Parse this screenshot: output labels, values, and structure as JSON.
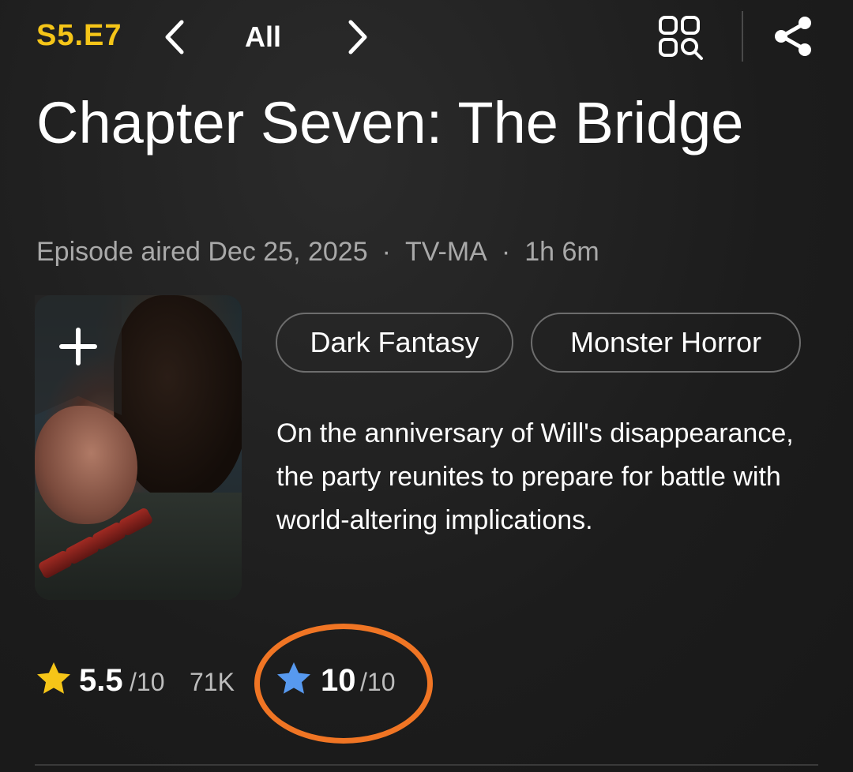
{
  "header": {
    "episode_code": "S5.E7",
    "filter_label": "All",
    "prev_icon": "chevron-left-icon",
    "next_icon": "chevron-right-icon",
    "grid_icon": "episode-grid-search-icon",
    "share_icon": "share-icon"
  },
  "episode": {
    "title": "Chapter Seven: The Bridge",
    "aired": "Episode aired Dec 25, 2025",
    "separator": "·",
    "certificate": "TV-MA",
    "runtime": "1h 6m",
    "plot": "On the anniversary of Will's disappearance, the party reunites to prepare for battle with world-altering implications."
  },
  "poster": {
    "add_icon": "plus-icon"
  },
  "genres": [
    "Dark Fantasy",
    "Monster Horror"
  ],
  "ratings": {
    "imdb": {
      "value": "5.5",
      "max": "/10",
      "count": "71K",
      "icon": "star-icon",
      "color": "#f5c518"
    },
    "user": {
      "value": "10",
      "max": "/10",
      "icon": "star-icon",
      "color": "#5799ef"
    }
  },
  "colors": {
    "accent": "#f5c518",
    "highlight_ring": "#f07524",
    "background": "#1f1f1f"
  }
}
